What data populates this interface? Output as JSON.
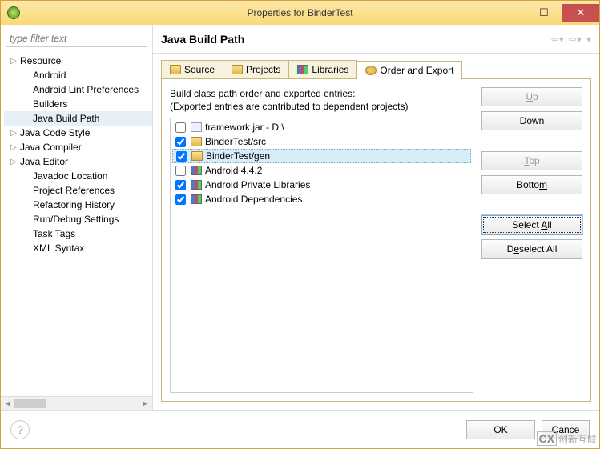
{
  "title": "Properties for BinderTest",
  "filter_placeholder": "type filter text",
  "tree": [
    {
      "label": "Resource",
      "expandable": true
    },
    {
      "label": "Android",
      "child": true
    },
    {
      "label": "Android Lint Preferences",
      "child": true
    },
    {
      "label": "Builders",
      "child": true
    },
    {
      "label": "Java Build Path",
      "child": true,
      "selected": true
    },
    {
      "label": "Java Code Style",
      "expandable": true
    },
    {
      "label": "Java Compiler",
      "expandable": true
    },
    {
      "label": "Java Editor",
      "expandable": true
    },
    {
      "label": "Javadoc Location",
      "child": true
    },
    {
      "label": "Project References",
      "child": true
    },
    {
      "label": "Refactoring History",
      "child": true
    },
    {
      "label": "Run/Debug Settings",
      "child": true
    },
    {
      "label": "Task Tags",
      "child": true
    },
    {
      "label": "XML Syntax",
      "child": true
    }
  ],
  "page_heading": "Java Build Path",
  "tabs": {
    "source": "Source",
    "projects": "Projects",
    "libraries": "Libraries",
    "order_export": "Order and Export"
  },
  "desc_line1_pre": "Build ",
  "desc_line1_u": "c",
  "desc_line1_post": "lass path order and exported entries:",
  "desc_line2": "(Exported entries are contributed to dependent projects)",
  "entries": [
    {
      "checked": false,
      "icon": "jar",
      "label": "framework.jar - D:\\"
    },
    {
      "checked": true,
      "indeterminate": true,
      "icon": "folder",
      "label": "BinderTest/src"
    },
    {
      "checked": true,
      "indeterminate": true,
      "icon": "folder",
      "label": "BinderTest/gen",
      "selected": true
    },
    {
      "checked": false,
      "icon": "lib",
      "label": "Android 4.4.2"
    },
    {
      "checked": true,
      "icon": "lib",
      "label": "Android Private Libraries"
    },
    {
      "checked": true,
      "icon": "lib",
      "label": "Android Dependencies"
    }
  ],
  "buttons": {
    "up_u": "U",
    "up_post": "p",
    "down": "Down",
    "top_pre": "",
    "top_u": "T",
    "top_post": "op",
    "bottom_pre": "Botto",
    "bottom_u": "m",
    "bottom_post": "",
    "selectall_pre": "Select ",
    "selectall_u": "A",
    "selectall_post": "ll",
    "deselectall_pre": "D",
    "deselectall_u": "e",
    "deselectall_post": "select All"
  },
  "footer": {
    "ok": "OK",
    "cancel": "Cance"
  },
  "watermark": "创新互联"
}
